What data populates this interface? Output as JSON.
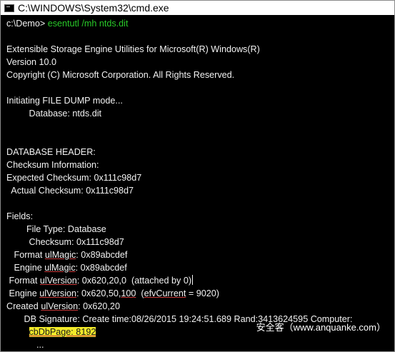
{
  "window": {
    "title": "C:\\WINDOWS\\System32\\cmd.exe"
  },
  "console": {
    "prompt": "c:\\Demo> ",
    "command": "esentutl /mh ntds.dit",
    "lines": {
      "l_banner": "Extensible Storage Engine Utilities for Microsoft(R) Windows(R)",
      "l_version": "Version 10.0",
      "l_copyright": "Copyright (C) Microsoft Corporation. All Rights Reserved.",
      "l_init": "Initiating FILE DUMP mode...",
      "l_database": "         Database: ntds.dit",
      "l_dbheader": "DATABASE HEADER:",
      "l_checksum_info": "Checksum Information:",
      "l_expected": "Expected Checksum: 0x111c98d7",
      "l_actual": "  Actual Checksum: 0x111c98d7",
      "l_fields": "Fields:",
      "l_filetype": "        File Type: Database",
      "l_checksum": "         Checksum: 0x111c98d7",
      "l_fmt_magic_pre": "   Format ",
      "l_fmt_magic_key": "ulMagic",
      "l_fmt_magic_val": ": 0x89abcdef",
      "l_eng_magic_pre": "   Engine ",
      "l_eng_magic_key": "ulMagic",
      "l_eng_magic_val": ": 0x89abcdef",
      "l_fmt_ver_pre": " Format ",
      "l_fmt_ver_key": "ulVersion",
      "l_fmt_ver_val": ": 0x620,20,0  (attached by 0)",
      "l_eng_ver_pre": " Engine ",
      "l_eng_ver_key": "ulVersion",
      "l_eng_ver_val": ": 0x620,50,",
      "l_eng_ver_num": "100",
      "l_eng_ver_tail": "  (",
      "l_eng_ver_efv": "efvCurrent",
      "l_eng_ver_end": " = 9020)",
      "l_created_pre": "Created ",
      "l_created_key": "ulVersion",
      "l_created_val": ": 0x620,20",
      "l_dbsig": "       DB Signature: Create time:08/26/2015 19:24:51.689 Rand:3413624595 Computer:",
      "l_pagesize_pre": "         ",
      "l_pagesize": "cbDbPage: 8192",
      "l_more": "            ..."
    }
  },
  "watermark": "安全客（www.anquanke.com）"
}
